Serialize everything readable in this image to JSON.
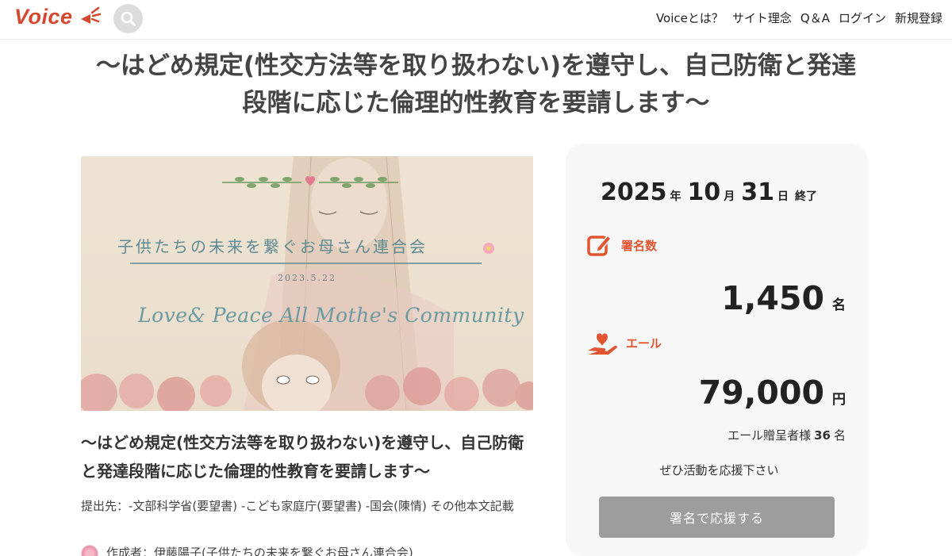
{
  "header": {
    "logo_text": "Voice",
    "search_icon": "search-icon",
    "nav": {
      "about": "Voiceとは？",
      "philosophy": "サイト理念",
      "qa": "Q＆A",
      "login": "ログイン",
      "signup": "新規登録"
    }
  },
  "campaign": {
    "title": "〜はどめ規定(性交方法等を取り扱わない)を遵守し、自己防衛と発達段階に応じた倫理的性教育を要請します〜",
    "image": {
      "title": "子供たちの未来を繋ぐお母さん連合会",
      "date": "2023.5.22",
      "script": "Love& Peace All Mothe's Community"
    },
    "destination": "提出先：-文部科学省(要望書) -こども家庭庁(要望書) -国会(陳情) その他本文記載",
    "author": "作成者：伊藤陽子(子供たちの未来を繋ぐお母さん連合会)"
  },
  "panel": {
    "deadline": {
      "year": "2025",
      "year_unit": "年",
      "month": "10",
      "month_unit": "月",
      "day": "31",
      "day_unit": "日",
      "status": "終了"
    },
    "signatures": {
      "label": "署名数",
      "value": "1,450",
      "unit": "名",
      "icon": "pencil-square-icon"
    },
    "cheer": {
      "label": "エール",
      "value": "79,000",
      "unit": "円",
      "icon": "heart-hand-icon"
    },
    "givers": {
      "label": "エール贈呈者様",
      "count": "36",
      "unit": "名"
    },
    "message": "ぜひ活動を応援下さい",
    "button": "署名で応援する"
  },
  "colors": {
    "brand": "#d6482e",
    "accent_orange": "#e2542f",
    "button_disabled": "#9d9d9d",
    "panel_bg": "#f7f7f7"
  }
}
